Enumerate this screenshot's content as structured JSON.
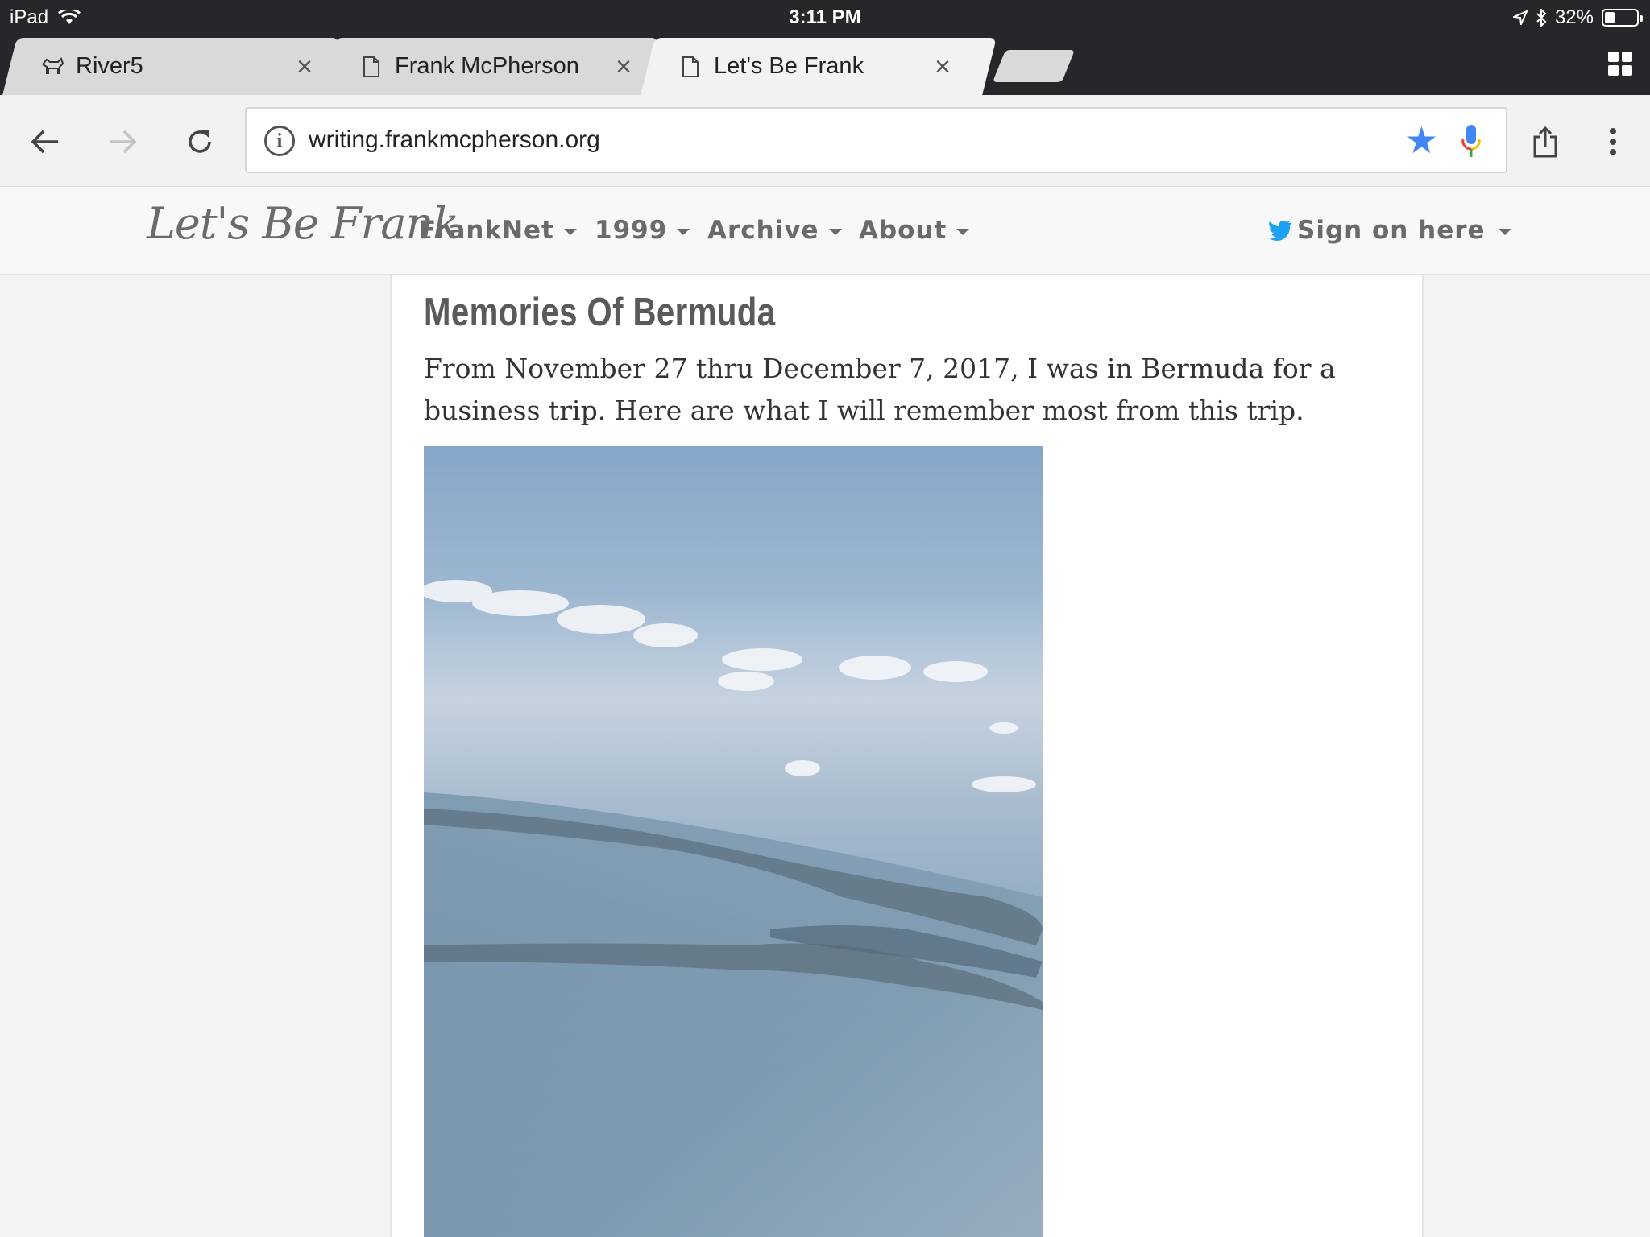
{
  "status_bar": {
    "device": "iPad",
    "time": "3:11 PM",
    "battery_percent": "32%",
    "battery_level": 0.32
  },
  "tabs": [
    {
      "title": "River5",
      "icon": "dog-icon",
      "active": false
    },
    {
      "title": "Frank McPherson",
      "icon": "page-icon",
      "active": false
    },
    {
      "title": "Let's Be Frank",
      "icon": "page-icon",
      "active": true
    }
  ],
  "toolbar": {
    "url": "writing.frankmcpherson.org"
  },
  "site_nav": {
    "brand": "Let's Be Frank",
    "items": [
      {
        "label": "FrankNet"
      },
      {
        "label": "1999"
      },
      {
        "label": "Archive"
      },
      {
        "label": "About"
      }
    ],
    "signon_label": "Sign on here"
  },
  "post": {
    "title": "Memories Of Bermuda",
    "body_line1": "From November 27 thru December 7, 2017, I was in Bermuda for a",
    "body_line2": "business trip. Here are what I will remember most from this trip."
  },
  "colors": {
    "chrome_dark": "#26272b",
    "star_blue": "#4285f4",
    "twitter_blue": "#1da1f2"
  }
}
